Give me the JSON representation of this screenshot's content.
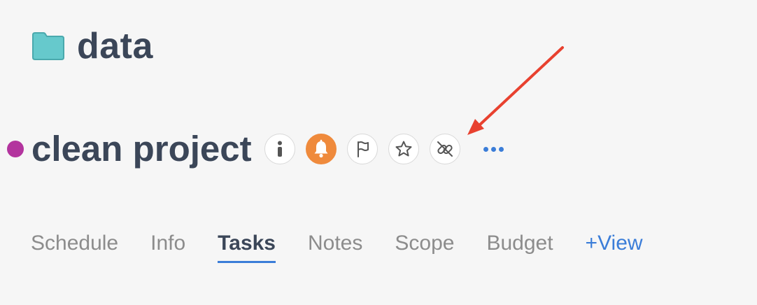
{
  "folder": {
    "name": "data",
    "icon": "folder-icon",
    "color": "#66c9cc"
  },
  "project": {
    "name": "clean project",
    "status_color": "#b3349e",
    "actions": [
      {
        "id": "info",
        "icon": "info-icon"
      },
      {
        "id": "alert",
        "icon": "bell-icon",
        "active_color": "#ef8a3c"
      },
      {
        "id": "flag",
        "icon": "flag-icon"
      },
      {
        "id": "favorite",
        "icon": "star-icon"
      },
      {
        "id": "unlink",
        "icon": "unlink-icon"
      },
      {
        "id": "more",
        "icon": "more-dots-icon"
      }
    ]
  },
  "annotation": {
    "icon": "red-arrow-icon",
    "color": "#e8412f",
    "points_to": "unlink"
  },
  "tabs": {
    "items": [
      {
        "label": "Schedule",
        "active": false
      },
      {
        "label": "Info",
        "active": false
      },
      {
        "label": "Tasks",
        "active": true
      },
      {
        "label": "Notes",
        "active": false
      },
      {
        "label": "Scope",
        "active": false
      },
      {
        "label": "Budget",
        "active": false
      }
    ],
    "add_view_label": "+View"
  },
  "colors": {
    "background": "#f6f6f6",
    "text_dark": "#3b4658",
    "text_muted": "#8c8c8c",
    "accent": "#3b7dd8"
  }
}
